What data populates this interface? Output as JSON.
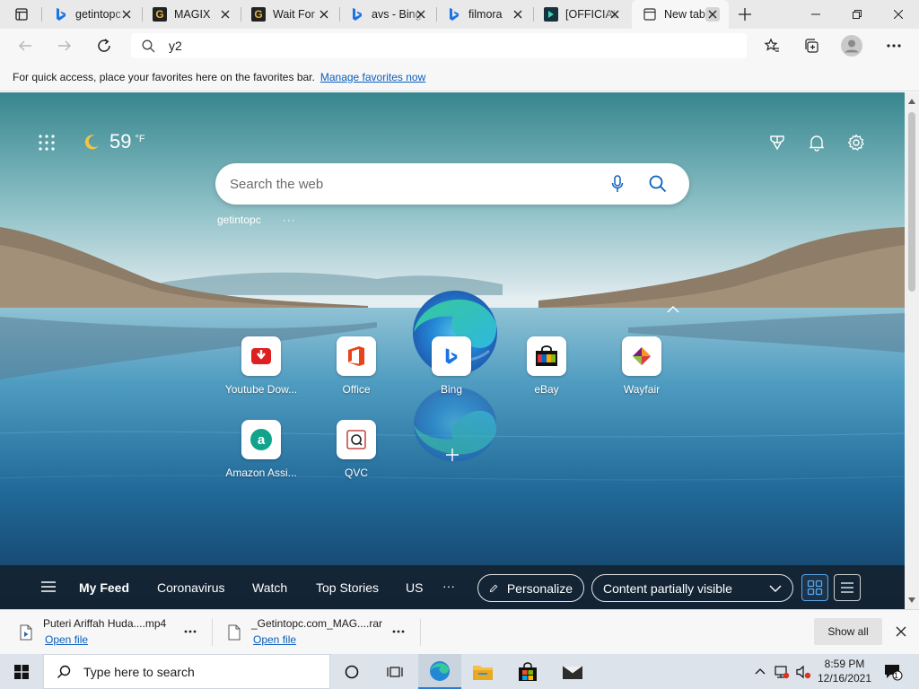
{
  "tabs": [
    {
      "title": "getintopc",
      "favicon": "bing-icon"
    },
    {
      "title": "MAGIX",
      "favicon": "getintopc-g-icon"
    },
    {
      "title": "Wait For",
      "favicon": "getintopc-g-icon"
    },
    {
      "title": "avs - Bing",
      "favicon": "bing-icon"
    },
    {
      "title": "filmora",
      "favicon": "bing-icon"
    },
    {
      "title": "[OFFICIAL",
      "favicon": "filmora-icon"
    },
    {
      "title": "New tab",
      "favicon": "newtab-page-icon",
      "active": true
    }
  ],
  "address": {
    "value": "y2"
  },
  "favorites_bar": {
    "message": "For quick access, place your favorites here on the favorites bar.",
    "link": "Manage favorites now"
  },
  "weather": {
    "temp": "59",
    "unit": "°F",
    "icon": "moon-icon"
  },
  "search": {
    "placeholder": "Search the web"
  },
  "recent_search": {
    "label": "getintopc",
    "more": "···"
  },
  "quick_links": [
    {
      "label": "Youtube Dow...",
      "icon": "youtube-downloader-icon"
    },
    {
      "label": "Office",
      "icon": "office-icon"
    },
    {
      "label": "Bing",
      "icon": "bing-icon"
    },
    {
      "label": "eBay",
      "icon": "ebay-icon"
    },
    {
      "label": "Wayfair",
      "icon": "wayfair-icon"
    },
    {
      "label": "Amazon Assi...",
      "icon": "amazon-assistant-icon"
    },
    {
      "label": "QVC",
      "icon": "qvc-icon"
    }
  ],
  "feed": {
    "items": [
      "My Feed",
      "Coronavirus",
      "Watch",
      "Top Stories",
      "US"
    ],
    "more": "···",
    "personalize": "Personalize",
    "content_dropdown": "Content partially visible"
  },
  "downloads": [
    {
      "name": "Puteri Ariffah Huda....mp4",
      "action": "Open file"
    },
    {
      "name": "_Getintopc.com_MAG....rar",
      "action": "Open file"
    }
  ],
  "downloads_show_all": "Show all",
  "taskbar": {
    "search_placeholder": "Type here to search",
    "time": "8:59 PM",
    "date": "12/16/2021",
    "notification_count": "1"
  },
  "colors": {
    "accent": "#0a5ebd",
    "feedbar": "#14202c"
  }
}
